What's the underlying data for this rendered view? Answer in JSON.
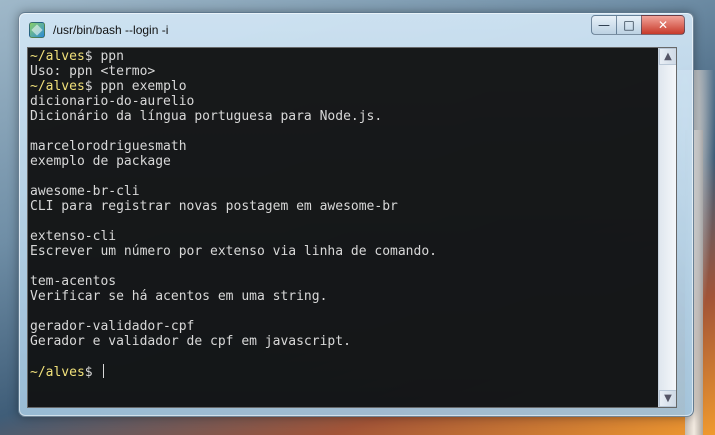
{
  "window": {
    "title": "/usr/bin/bash --login -i",
    "controls": {
      "minimize": "—",
      "maximize": "□",
      "close": "✕"
    }
  },
  "terminal": {
    "lines": [
      {
        "type": "prompt",
        "user": "~/alves",
        "sym": "$",
        "cmd": " ppn"
      },
      {
        "type": "text",
        "text": "Uso: ppn <termo>"
      },
      {
        "type": "prompt",
        "user": "~/alves",
        "sym": "$",
        "cmd": " ppn exemplo"
      },
      {
        "type": "text",
        "text": "dicionario-do-aurelio"
      },
      {
        "type": "text",
        "text": "Dicionário da língua portuguesa para Node.js."
      },
      {
        "type": "text",
        "text": ""
      },
      {
        "type": "text",
        "text": "marcelorodriguesmath"
      },
      {
        "type": "text",
        "text": "exemplo de package"
      },
      {
        "type": "text",
        "text": ""
      },
      {
        "type": "text",
        "text": "awesome-br-cli"
      },
      {
        "type": "text",
        "text": "CLI para registrar novas postagem em awesome-br"
      },
      {
        "type": "text",
        "text": ""
      },
      {
        "type": "text",
        "text": "extenso-cli"
      },
      {
        "type": "text",
        "text": "Escrever um número por extenso via linha de comando."
      },
      {
        "type": "text",
        "text": ""
      },
      {
        "type": "text",
        "text": "tem-acentos"
      },
      {
        "type": "text",
        "text": "Verificar se há acentos em uma string."
      },
      {
        "type": "text",
        "text": ""
      },
      {
        "type": "text",
        "text": "gerador-validador-cpf"
      },
      {
        "type": "text",
        "text": "Gerador e validador de cpf em javascript."
      },
      {
        "type": "text",
        "text": ""
      },
      {
        "type": "prompt",
        "user": "~/alves",
        "sym": "$",
        "cmd": " ",
        "cursor": true
      }
    ]
  },
  "scrollbar": {
    "up_arrow": "▲",
    "down_arrow": "▼"
  },
  "colors": {
    "prompt_user": "#f0e07a",
    "terminal_text": "#d8d8d8",
    "terminal_bg": "#0a0a0a"
  }
}
